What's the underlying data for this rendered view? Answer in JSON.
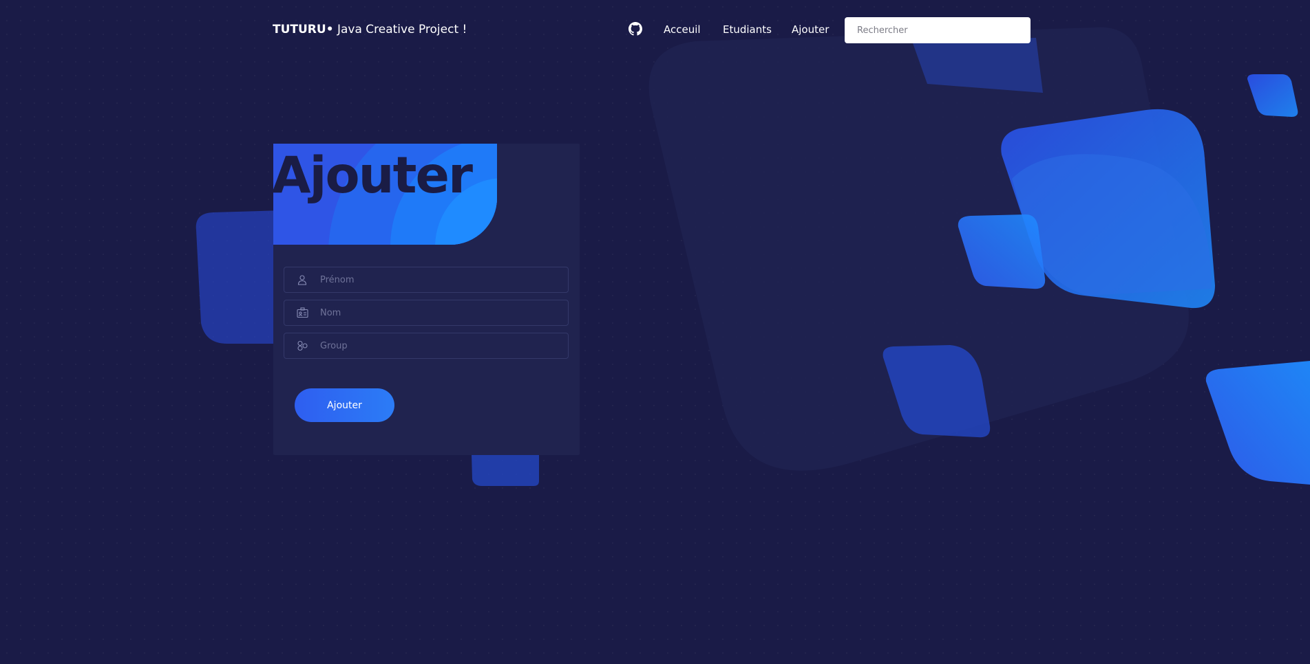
{
  "navbar": {
    "brand_strong": "TUTURU•",
    "brand_rest": " Java Creative Project !",
    "links": [
      {
        "label": "Acceuil"
      },
      {
        "label": "Etudiants"
      },
      {
        "label": "Ajouter"
      }
    ],
    "search_placeholder": "Rechercher"
  },
  "form": {
    "title": "Ajouter",
    "fields": [
      {
        "placeholder": "Prénom",
        "icon": "user-icon"
      },
      {
        "placeholder": "Nom",
        "icon": "id-card-icon"
      },
      {
        "placeholder": "Group",
        "icon": "group-icon"
      }
    ],
    "submit_label": "Ajouter"
  },
  "colors": {
    "background": "#1a1b47",
    "card": "#20234f",
    "accent_blue": "#2f63ef",
    "accent_light_blue": "#1f8bff",
    "text_dark": "#1a1c45"
  }
}
